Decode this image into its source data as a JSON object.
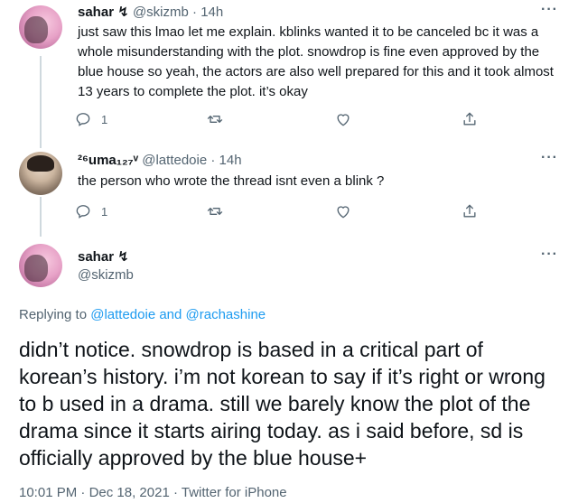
{
  "tweet1": {
    "display_name": "sahar",
    "name_symbol": "↯",
    "handle": "@skizmb",
    "separator": "·",
    "time": "14h",
    "more": "···",
    "text": "just saw this lmao let me explain. kblinks wanted it to be canceled bc it was a whole misunderstanding with the plot. snowdrop is fine even approved by the blue house so yeah, the actors are also well prepared for this and it took almost 13 years to complete the plot. it’s okay",
    "reply_count": "1"
  },
  "tweet2": {
    "display_name": "²⁶uma₁₂₇ᵛ",
    "handle": "@lattedoie",
    "separator": "·",
    "time": "14h",
    "more": "···",
    "text": "the person who wrote the thread isnt even a blink ?",
    "reply_count": "1"
  },
  "main_tweet": {
    "display_name": "sahar",
    "name_symbol": "↯",
    "handle": "@skizmb",
    "more": "···",
    "replying_prefix": "Replying to",
    "replying_users": "@lattedoie and @rachashine",
    "text": "didn’t notice. snowdrop is based in a critical part of korean’s history. i’m not korean to say if it’s right or wrong to b used in a drama. still we barely know the plot of the drama since it starts airing today. as i said before, sd is officially approved by the blue house+",
    "timestamp": "10:01 PM",
    "date": "Dec 18, 2021",
    "source": "Twitter for iPhone",
    "separator": "·"
  },
  "icons": [
    "reply-icon",
    "retweet-icon",
    "like-icon",
    "share-icon",
    "more-icon"
  ],
  "colors": {
    "link": "#1d9bf0",
    "muted": "#536471",
    "text": "#0f1419",
    "thread_line": "#cfd9de"
  }
}
